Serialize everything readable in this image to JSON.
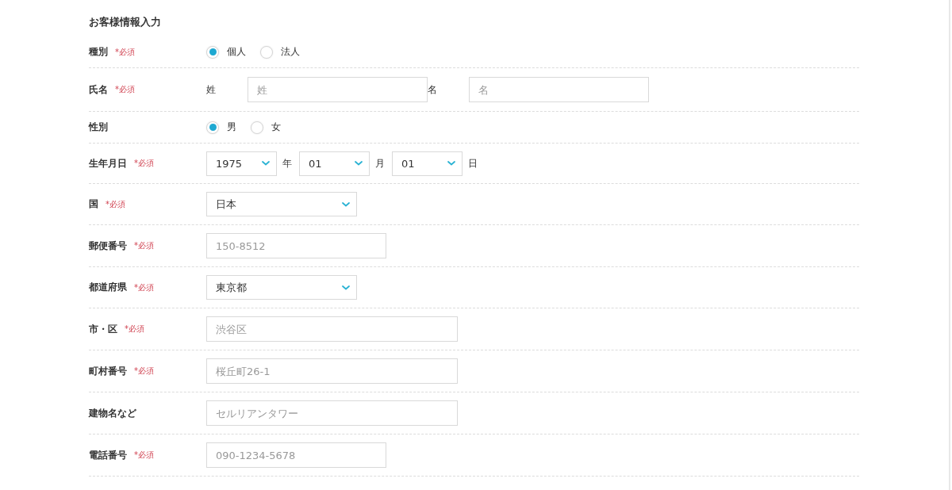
{
  "title": "お客様情報入力",
  "rows": [
    {
      "kind": "radio",
      "label": "種別",
      "required_text": "*必須",
      "options": [
        {
          "label": "個人",
          "selected": true
        },
        {
          "label": "法人",
          "selected": false
        }
      ]
    },
    {
      "kind": "name",
      "label": "氏名",
      "required_text": "*必須",
      "parts": [
        {
          "caption": "姓",
          "placeholder": "姓"
        },
        {
          "caption": "名",
          "placeholder": "名"
        }
      ]
    },
    {
      "kind": "radio",
      "label": "性別",
      "options": [
        {
          "label": "男",
          "selected": true
        },
        {
          "label": "女",
          "selected": false
        }
      ]
    },
    {
      "kind": "date",
      "label": "生年月日",
      "required_text": "*必須",
      "parts": [
        {
          "value": "1975",
          "unit": "年"
        },
        {
          "value": "01",
          "unit": "月"
        },
        {
          "value": "01",
          "unit": "日"
        }
      ]
    },
    {
      "kind": "select",
      "label": "国",
      "required_text": "*必須",
      "value": "日本"
    },
    {
      "kind": "text",
      "label": "郵便番号",
      "required_text": "*必須",
      "placeholder": "150-8512"
    },
    {
      "kind": "select",
      "label": "都道府県",
      "required_text": "*必須",
      "value": "東京都"
    },
    {
      "kind": "wide-text",
      "label": "市・区",
      "required_text": "*必須",
      "placeholder": "渋谷区"
    },
    {
      "kind": "wide-text",
      "label": "町村番号",
      "required_text": "*必須",
      "placeholder": "桜丘町26-1"
    },
    {
      "kind": "wide-text",
      "label": "建物名など",
      "placeholder": "セルリアンタワー"
    },
    {
      "kind": "text",
      "label": "電話番号",
      "required_text": "*必須",
      "placeholder": "090-1234-5678"
    }
  ]
}
